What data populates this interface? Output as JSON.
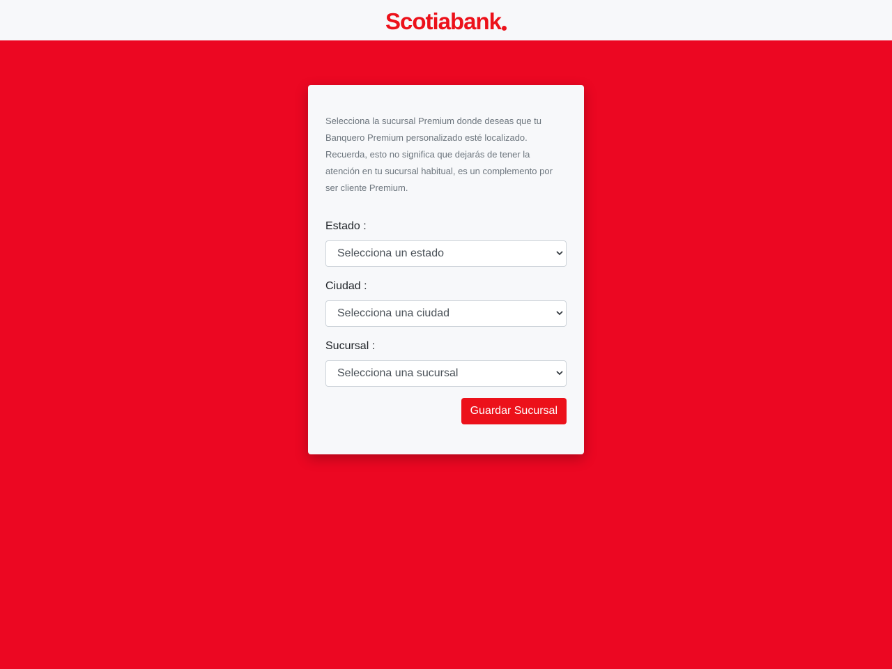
{
  "header": {
    "logo_text": "Scotiabank",
    "brand_color": "#ec111a"
  },
  "page": {
    "background_color": "#ec0722"
  },
  "form": {
    "intro_text": "Selecciona la sucursal Premium donde deseas que tu Banquero Premium personalizado esté localizado. Recuerda, esto no significa que dejarás de tener la atención en tu sucursal habitual, es un complemento por ser cliente Premium.",
    "estado": {
      "label": "Estado :",
      "value": "Selecciona un estado"
    },
    "ciudad": {
      "label": "Ciudad :",
      "value": "Selecciona una ciudad"
    },
    "sucursal": {
      "label": "Sucursal :",
      "value": "Selecciona una sucursal"
    },
    "save_label": "Guardar Sucursal",
    "icons": {
      "dropdown": "chevron-down-icon"
    }
  }
}
